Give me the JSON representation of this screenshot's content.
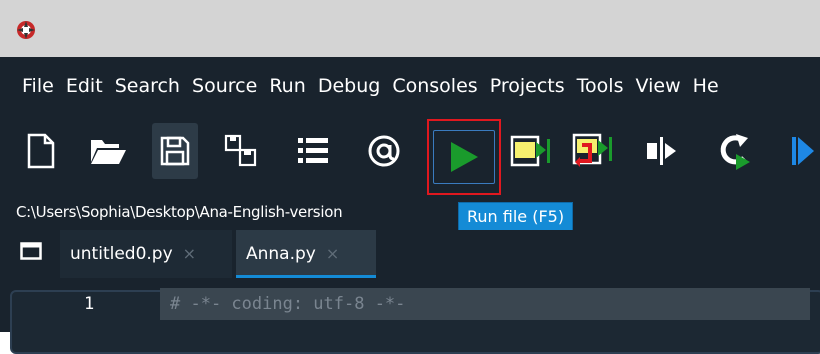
{
  "menubar": {
    "items": [
      "File",
      "Edit",
      "Search",
      "Source",
      "Run",
      "Debug",
      "Consoles",
      "Projects",
      "Tools",
      "View",
      "He"
    ]
  },
  "toolbar": {
    "icons": [
      "new-file-icon",
      "open-folder-icon",
      "save-icon",
      "save-all-icon",
      "list-icon",
      "at-icon",
      "run-icon",
      "run-cell-icon",
      "run-cell-advance-icon",
      "run-selection-icon",
      "re-run-icon",
      "debug-icon"
    ]
  },
  "path": "C:\\Users\\Sophia\\Desktop\\Ana-English-version",
  "tooltip": "Run file (F5)",
  "tabs": [
    {
      "label": "untitled0.py",
      "close": "×"
    },
    {
      "label": "Anna.py",
      "close": "×"
    }
  ],
  "editor": {
    "line_number": "1",
    "code": "# -*- coding: utf-8 -*-"
  },
  "colors": {
    "background": "#19232d",
    "run_green": "#1a9b2c",
    "highlight_red": "#e0181f",
    "tooltip_blue": "#148bd6"
  }
}
